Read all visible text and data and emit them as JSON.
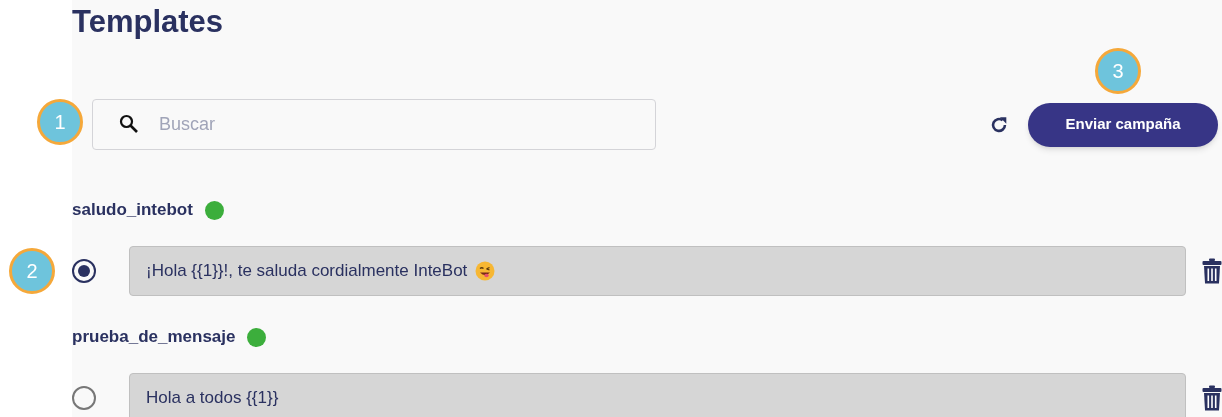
{
  "title": "Templates",
  "search": {
    "placeholder": "Buscar"
  },
  "send_button": "Enviar campaña",
  "templates": [
    {
      "name": "saludo_intebot",
      "color": "#3cae3c",
      "selected": true,
      "message": "¡Hola {{1}}!, te saluda cordialmente InteBot",
      "kind": "emoji"
    },
    {
      "name": "prueba_de_mensaje",
      "color": "#3cae3c",
      "selected": false,
      "message": "Hola a todos {{1}}"
    }
  ],
  "callouts": [
    "1",
    "2",
    "3"
  ]
}
